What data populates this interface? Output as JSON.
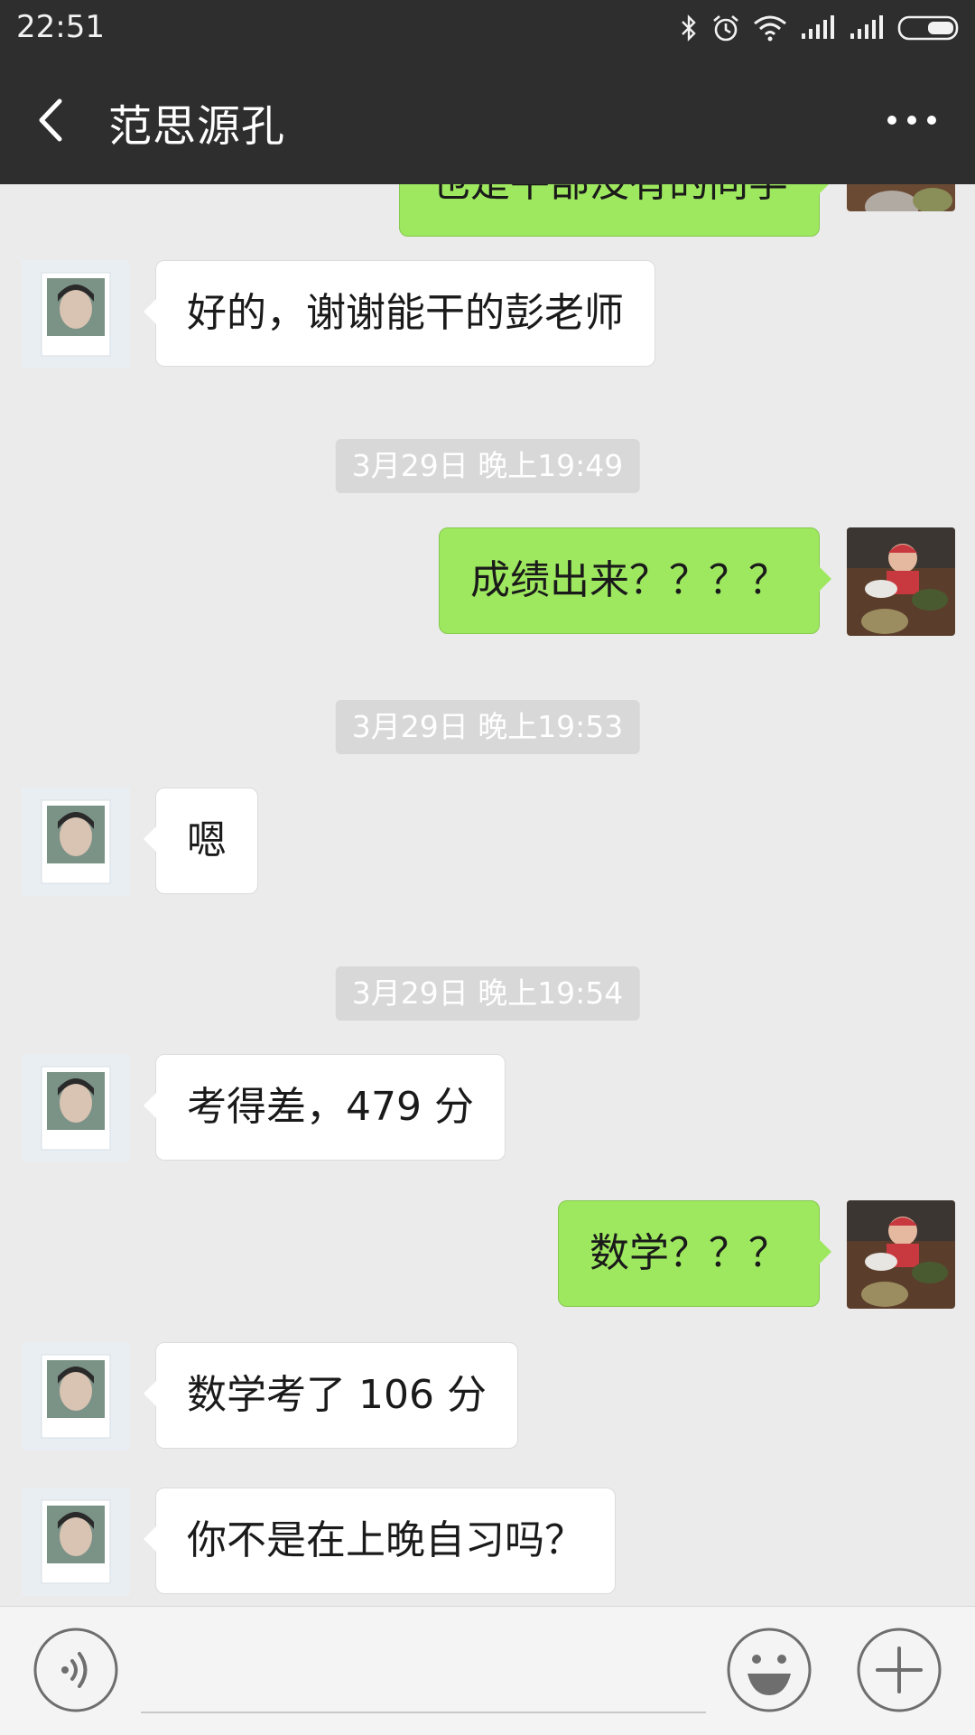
{
  "status_bar": {
    "time": "22:51"
  },
  "header": {
    "title": "范思源孔"
  },
  "messages": [
    {
      "side": "out",
      "text": "也是平部没有的同学"
    },
    {
      "side": "in",
      "text": "好的，谢谢能干的彭老师"
    },
    {
      "type": "time",
      "text": "3月29日 晚上19:49"
    },
    {
      "side": "out",
      "text": "成绩出来？？？？"
    },
    {
      "type": "time",
      "text": "3月29日 晚上19:53"
    },
    {
      "side": "in",
      "text": "嗯"
    },
    {
      "type": "time",
      "text": "3月29日 晚上19:54"
    },
    {
      "side": "in",
      "text": "考得差，479 分"
    },
    {
      "side": "out",
      "text": "数学？？？"
    },
    {
      "side": "in",
      "text": "数学考了 106 分"
    },
    {
      "side": "in",
      "text": "你不是在上晚自习吗？"
    }
  ],
  "colors": {
    "header_bg": "#2e2e2e",
    "chat_bg": "#ebebeb",
    "out_bubble": "#9ee85f",
    "in_bubble": "#ffffff",
    "timestamp_bg": "#d8d8d8"
  },
  "icons": [
    "back-arrow-icon",
    "more-dots-icon",
    "voice-icon",
    "emoji-icon",
    "plus-icon",
    "bluetooth-icon",
    "alarm-icon",
    "wifi-icon",
    "signal-icon",
    "battery-icon"
  ]
}
